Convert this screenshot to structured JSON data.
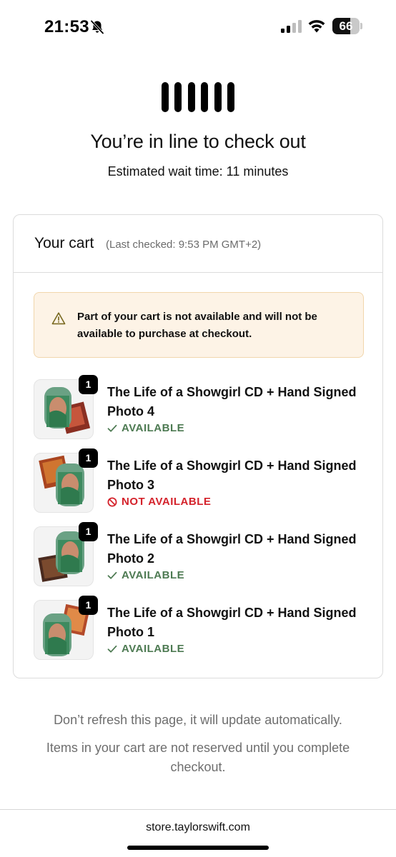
{
  "status_bar": {
    "time": "21:53",
    "battery_percent": "66",
    "icons": [
      "bell-slash-icon",
      "cellular-signal-icon",
      "wifi-icon",
      "battery-icon"
    ]
  },
  "queue": {
    "title": "You’re in line to check out",
    "wait_time": "Estimated wait time: 11 minutes"
  },
  "cart": {
    "title": "Your cart",
    "last_checked": "(Last checked: 9:53 PM GMT+2)",
    "alert": {
      "icon": "warning-triangle-icon",
      "text": "Part of your cart is not available and will not be available to purchase at checkout."
    },
    "items": [
      {
        "name": "The Life of a Showgirl CD + Hand Signed Photo 4",
        "quantity": "1",
        "status": "AVAILABLE",
        "available": true
      },
      {
        "name": "The Life of a Showgirl CD + Hand Signed Photo 3",
        "quantity": "1",
        "status": "NOT AVAILABLE",
        "available": false
      },
      {
        "name": "The Life of a Showgirl CD + Hand Signed Photo 2",
        "quantity": "1",
        "status": "AVAILABLE",
        "available": true
      },
      {
        "name": "The Life of a Showgirl CD + Hand Signed Photo 1",
        "quantity": "1",
        "status": "AVAILABLE",
        "available": true
      }
    ]
  },
  "footer": {
    "note_refresh": "Don’t refresh this page, it will update automatically.",
    "note_reserved": "Items in your cart are not reserved until you complete checkout."
  },
  "browser": {
    "url": "store.taylorswift.com"
  },
  "colors": {
    "available": "#4d7a52",
    "not_available": "#d4222b",
    "alert_bg": "#fdf3e6",
    "alert_border": "#f1d6ac"
  }
}
